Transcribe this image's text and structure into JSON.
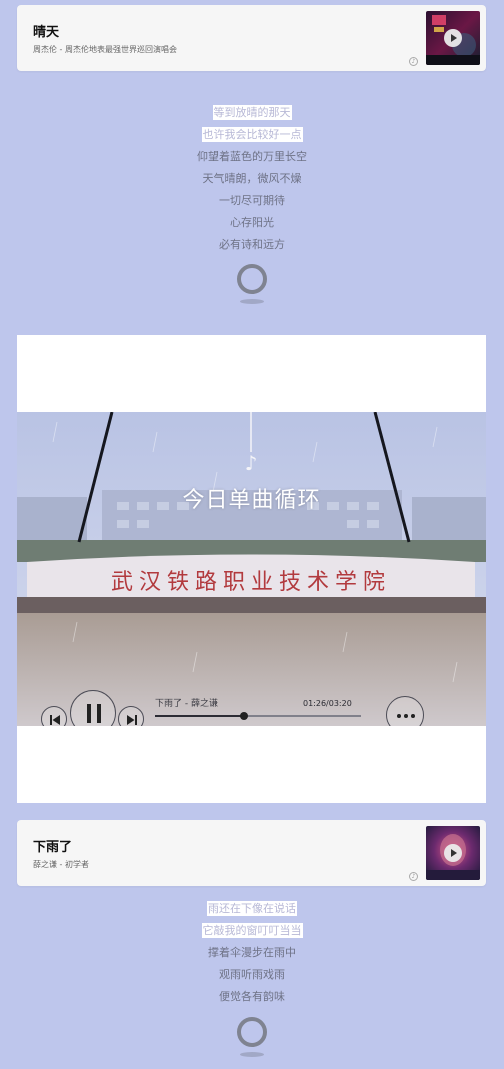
{
  "songs": [
    {
      "title": "晴天",
      "subtitle": "周杰伦 - 周杰伦地表最强世界巡回演唱会",
      "cover_icon": "album-cover-concert",
      "play_icon": "play-icon",
      "logo_icon": "netease-logo-icon",
      "lyrics": [
        {
          "text": "等到放晴的那天",
          "highlight": true
        },
        {
          "text": "也许我会比较好一点",
          "highlight": true
        },
        {
          "text": "仰望着蓝色的万里长空",
          "highlight": false
        },
        {
          "text": "天气晴朗，微风不燥",
          "highlight": false
        },
        {
          "text": "一切尽可期待",
          "highlight": false
        },
        {
          "text": "心存阳光",
          "highlight": false
        },
        {
          "text": "必有诗和远方",
          "highlight": false
        }
      ]
    },
    {
      "title": "下雨了",
      "subtitle": "薛之谦 - 初学者",
      "cover_icon": "album-cover-portrait",
      "play_icon": "play-icon",
      "logo_icon": "netease-logo-icon",
      "lyrics": [
        {
          "text": "雨还在下像在说话",
          "highlight": true
        },
        {
          "text": "它敲我的窗叮叮当当",
          "highlight": true
        },
        {
          "text": "撑着伞漫步在雨中",
          "highlight": false
        },
        {
          "text": "观雨听雨戏雨",
          "highlight": false
        },
        {
          "text": "便觉各有韵味",
          "highlight": false
        }
      ]
    }
  ],
  "video": {
    "overlay_title": "今日单曲循环",
    "song_line": "下雨了 - 薛之谦",
    "time_display": "01:26/03:20",
    "progress": 0.43,
    "icons": {
      "prev": "skip-previous-icon",
      "pause": "pause-icon",
      "next": "skip-next-icon",
      "more": "more-options-icon"
    }
  },
  "colors": {
    "page_bg": "#bec6ec",
    "card_bg": "#f6f6f6",
    "lyric_text": "#6e7286",
    "lyric_highlight_bg": "#ffffff",
    "lyric_highlight_text": "#b7b8d6"
  }
}
